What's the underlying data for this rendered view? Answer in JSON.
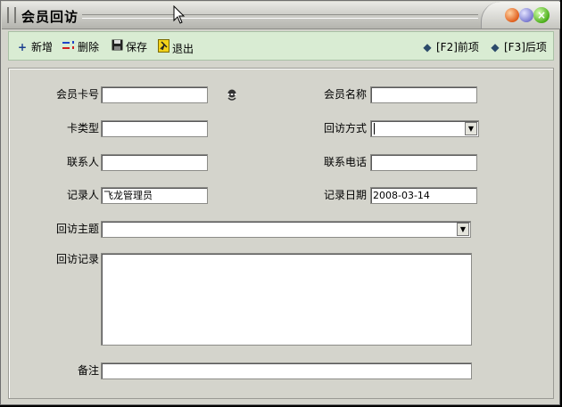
{
  "window": {
    "title": "会员回访"
  },
  "toolbar": {
    "new": "新增",
    "delete": "删除",
    "save": "保存",
    "exit": "退出",
    "prev": "[F2]前项",
    "next": "[F3]后项"
  },
  "form": {
    "card_no": {
      "label": "会员卡号",
      "value": ""
    },
    "member_name": {
      "label": "会员名称",
      "value": ""
    },
    "card_type": {
      "label": "卡类型",
      "value": ""
    },
    "visit_method": {
      "label": "回访方式",
      "value": ""
    },
    "contact": {
      "label": "联系人",
      "value": ""
    },
    "phone": {
      "label": "联系电话",
      "value": ""
    },
    "recorder": {
      "label": "记录人",
      "value": "飞龙管理员"
    },
    "record_date": {
      "label": "记录日期",
      "value": "2008-03-14"
    },
    "subject": {
      "label": "回访主题",
      "value": ""
    },
    "record": {
      "label": "回访记录",
      "value": ""
    },
    "remark": {
      "label": "备注",
      "value": ""
    }
  },
  "colors": {
    "toolbar_bg": "#d9ecd3",
    "window_bg": "#d4d4cc"
  }
}
